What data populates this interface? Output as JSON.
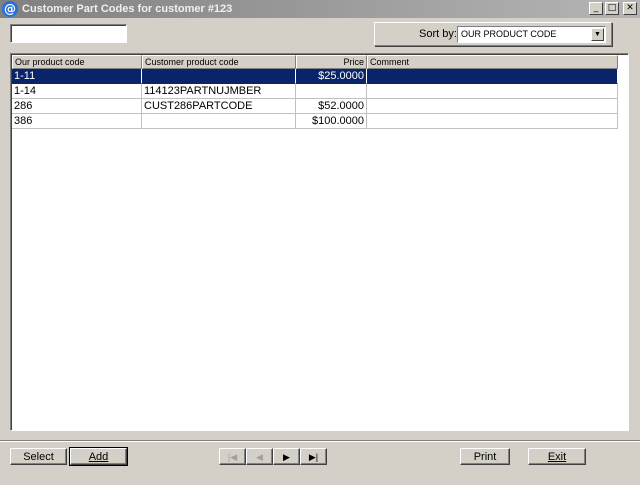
{
  "window": {
    "title": "Customer Part Codes for customer #123",
    "icon_glyph": "@"
  },
  "search": {
    "value": ""
  },
  "sort": {
    "label": "Sort by:",
    "selected": "OUR PRODUCT CODE"
  },
  "table": {
    "headers": [
      "Our product code",
      "Customer product code",
      "Price",
      "Comment"
    ],
    "rows": [
      {
        "our_code": "1-11",
        "customer_code": "",
        "price": "$25.0000",
        "comment": "",
        "selected": true
      },
      {
        "our_code": "1-14",
        "customer_code": "114123PARTNUJMBER",
        "price": "",
        "comment": "",
        "selected": false
      },
      {
        "our_code": "286",
        "customer_code": "CUST286PARTCODE",
        "price": "$52.0000",
        "comment": "",
        "selected": false
      },
      {
        "our_code": "386",
        "customer_code": "",
        "price": "$100.0000",
        "comment": "",
        "selected": false
      }
    ]
  },
  "buttons": {
    "select": "Select",
    "add": "Add",
    "print": "Print",
    "exit": "Exit",
    "nav_first": "|◀",
    "nav_prev": "◀",
    "nav_next": "▶",
    "nav_last": "▶|"
  },
  "colors": {
    "selection": "#0a246a",
    "face": "#d4d0c8"
  }
}
